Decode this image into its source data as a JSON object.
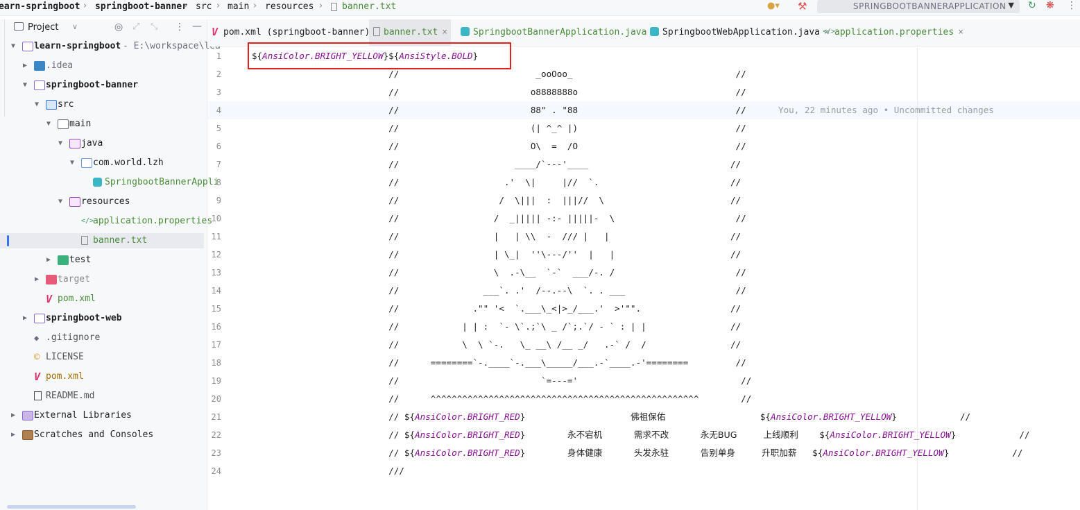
{
  "breadcrumb": [
    "earn-springboot",
    "springboot-banner",
    "src",
    "main",
    "resources",
    "banner.txt"
  ],
  "run_config": {
    "name": "SPRINGBOOTBANNERAPPLICATION"
  },
  "project_panel": {
    "title": "Project",
    "tree": [
      {
        "label": "learn-springboot",
        "hint": "- E:\\workspace\\lea",
        "icon": "module-folder-icon",
        "depth": 0,
        "arrow": "down"
      },
      {
        "label": ".idea",
        "icon": "idea-folder-icon",
        "depth": 1,
        "arrow": "right"
      },
      {
        "label": "springboot-banner",
        "icon": "module-folder-icon",
        "depth": 1,
        "arrow": "down"
      },
      {
        "label": "src",
        "icon": "source-folder-icon",
        "depth": 2,
        "arrow": "down"
      },
      {
        "label": "main",
        "icon": "folder-icon",
        "depth": 3,
        "arrow": "down"
      },
      {
        "label": "java",
        "icon": "java-folder-icon",
        "depth": 4,
        "arrow": "down"
      },
      {
        "label": "com.world.lzh",
        "icon": "package-icon",
        "depth": 5,
        "arrow": "down"
      },
      {
        "label": "SpringbootBannerAppli",
        "icon": "spring-class-icon",
        "depth": 6,
        "arrow": ""
      },
      {
        "label": "resources",
        "icon": "resources-folder-icon",
        "depth": 4,
        "arrow": "down"
      },
      {
        "label": "application.properties",
        "icon": "properties-icon",
        "depth": 5,
        "arrow": ""
      },
      {
        "label": "banner.txt",
        "icon": "text-file-icon",
        "depth": 5,
        "arrow": ""
      },
      {
        "label": "test",
        "icon": "test-folder-icon",
        "depth": 3,
        "arrow": "right"
      },
      {
        "label": "target",
        "icon": "target-folder-icon",
        "depth": 2,
        "arrow": "right"
      },
      {
        "label": "pom.xml",
        "icon": "maven-icon",
        "depth": 2,
        "arrow": ""
      },
      {
        "label": "springboot-web",
        "icon": "module-folder-icon",
        "depth": 1,
        "arrow": "right"
      },
      {
        "label": ".gitignore",
        "icon": "gitignore-icon",
        "depth": 1,
        "arrow": ""
      },
      {
        "label": "LICENSE",
        "icon": "license-icon",
        "depth": 1,
        "arrow": ""
      },
      {
        "label": "pom.xml",
        "icon": "maven-icon",
        "depth": 1,
        "arrow": ""
      },
      {
        "label": "README.md",
        "icon": "markdown-icon",
        "depth": 1,
        "arrow": ""
      },
      {
        "label": "External Libraries",
        "icon": "library-icon",
        "depth": 0,
        "arrow": "right"
      },
      {
        "label": "Scratches and Consoles",
        "icon": "scratches-icon",
        "depth": 0,
        "arrow": "right"
      }
    ]
  },
  "tabs": [
    {
      "label": "pom.xml (springboot-banner)",
      "icon": "maven-icon"
    },
    {
      "label": "banner.txt",
      "icon": "text-file-icon"
    },
    {
      "label": "SpringbootBannerApplication.java",
      "icon": "spring-class-icon"
    },
    {
      "label": "SpringbootWebApplication.java",
      "icon": "spring-class-icon"
    },
    {
      "label": "application.properties",
      "icon": "properties-icon"
    }
  ],
  "editor": {
    "blame": "You, 22 minutes ago • Uncommitted changes",
    "lines": [
      "${AnsiColor.BRIGHT_YELLOW}${AnsiStyle.BOLD}",
      "                          //                          _ooOoo_                               //",
      "                          //                         o8888888o                              //",
      "                          //                         88\" . \"88                              //",
      "                          //                         (| ^_^ |)                              //",
      "                          //                         O\\  =  /O                              //",
      "                          //                      ____/`---'____                           //",
      "                          //                    .'  \\|     |//  `.                         //",
      "                          //                   /  \\|||  :  |||//  \\                        //",
      "                          //                  /  _||||| -:- |||||-  \\                       //",
      "                          //                  |   | \\\\  -  /// |   |                       //",
      "                          //                  | \\_|  ''\\---/''  |   |                      //",
      "                          //                  \\  .-\\__  `-`  ___/-. /                       //",
      "                          //                ___`. .'  /--.--\\  `. . ___                     //",
      "                          //              .\"\" '<  `.___\\_<|>_/___.'  >'\"\".                 //",
      "                          //            | | :  `- \\`.;`\\ _ /`;.`/ - ` : | |                //",
      "                          //            \\  \\ `-.   \\_ __\\ /__ _/   .-` /  /                //",
      "                          //      ========`-.____`-.___\\_____/___.-`____.-'========         //",
      "                          //                           `=---='                               //",
      "                          //      ^^^^^^^^^^^^^^^^^^^^^^^^^^^^^^^^^^^^^^^^^^^^^^^^^^^        //",
      "                          // ${AnsiColor.BRIGHT_RED}                    佛祖保佑                  ${AnsiColor.BRIGHT_YELLOW}            //",
      "                          // ${AnsiColor.BRIGHT_RED}        永不宕机      需求不改      永无BUG     上线顺利    ${AnsiColor.BRIGHT_YELLOW}            //",
      "                          // ${AnsiColor.BRIGHT_RED}        身体健康      头发永驻      告别单身     升职加薪   ${AnsiColor.BRIGHT_YELLOW}            //",
      "                          ///"
    ]
  }
}
